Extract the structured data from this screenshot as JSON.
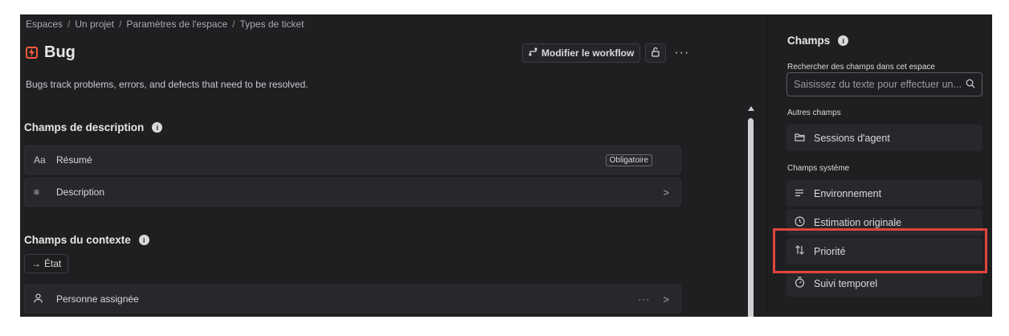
{
  "breadcrumb": [
    "Espaces",
    "Un projet",
    "Paramètres de l'espace",
    "Types de ticket"
  ],
  "issue_type": {
    "title": "Bug",
    "description": "Bugs track problems, errors, and defects that need to be resolved.",
    "icon": "bug-type-icon",
    "icon_color": "#f15b3a"
  },
  "header": {
    "modify_workflow_label": "Modifier le workflow",
    "more_label": "···"
  },
  "description_fields": {
    "title": "Champs de description",
    "rows": [
      {
        "icon": "Aa",
        "label": "Résumé",
        "badge": "Obligatoire"
      },
      {
        "icon": "≡",
        "label": "Description",
        "chevron": ">"
      }
    ]
  },
  "context_fields": {
    "title": "Champs du contexte",
    "status_pill": "État",
    "status_arrow": "→",
    "rows": [
      {
        "icon": "person-icon",
        "label": "Personne assignée",
        "more": "···",
        "chevron": ">"
      }
    ]
  },
  "sidebar": {
    "title": "Champs",
    "search_label": "Rechercher des champs dans cet espace",
    "search_placeholder": "Saisissez du texte pour effectuer un...",
    "other_fields_label": "Autres champs",
    "other_fields": [
      {
        "icon": "folder-icon",
        "label": "Sessions d'agent"
      }
    ],
    "system_fields_label": "Champs système",
    "system_fields": [
      {
        "icon": "lines-icon",
        "label": "Environnement"
      },
      {
        "icon": "clock-icon",
        "label": "Estimation originale"
      },
      {
        "icon": "sort-arrows-icon",
        "label": "Priorité"
      },
      {
        "icon": "stopwatch-icon",
        "label": "Suivi temporel"
      }
    ]
  },
  "colors": {
    "highlight": "#e0453c",
    "background": "#1f1f21"
  }
}
